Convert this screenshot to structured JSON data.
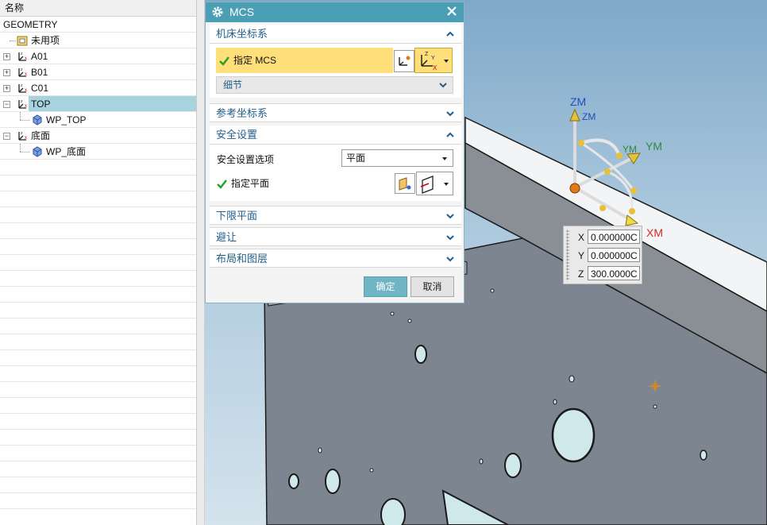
{
  "navigator": {
    "column_header": "名称",
    "items": [
      {
        "label": "GEOMETRY"
      },
      {
        "label": "未用项"
      },
      {
        "label": "A01"
      },
      {
        "label": "B01"
      },
      {
        "label": "C01"
      },
      {
        "label": "TOP"
      },
      {
        "label": "WP_TOP"
      },
      {
        "label": "底面"
      },
      {
        "label": "WP_底面"
      }
    ]
  },
  "dialog": {
    "title": "MCS",
    "sections": {
      "machine_csys": {
        "title": "机床坐标系",
        "specify_mcs": "指定 MCS",
        "details": "细节"
      },
      "reference_csys": {
        "title": "参考坐标系"
      },
      "clearance": {
        "title": "安全设置",
        "option_label": "安全设置选项",
        "option_value": "平面",
        "specify_plane": "指定平面"
      },
      "lower_limit": {
        "title": "下限平面"
      },
      "avoidance": {
        "title": "避让"
      },
      "layout": {
        "title": "布局和图层"
      }
    },
    "ok": "确定",
    "cancel": "取消"
  },
  "triad": {
    "zm": "ZM",
    "zm_small": "ZM",
    "ym": "YM",
    "ym_small": "YM",
    "xm": "XM"
  },
  "coord_input": {
    "x_label": "X",
    "x_value": "0.000000C",
    "y_label": "Y",
    "y_value": "0.000000C",
    "z_label": "Z",
    "z_value": "300.0000C"
  },
  "colors": {
    "title_bar": "#4b9fb5",
    "selection": "#a6d3dd",
    "highlight_row": "#fedf7a",
    "section_text": "#1f5e8a",
    "ok_button": "#70b5c5",
    "part_face": "#7d8590"
  }
}
